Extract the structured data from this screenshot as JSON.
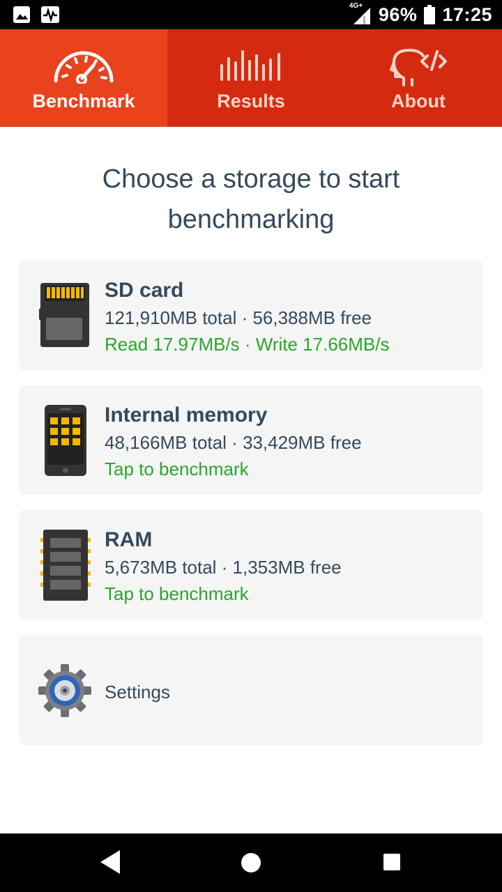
{
  "status_bar": {
    "network_type": "4G+",
    "battery": "96%",
    "time": "17:25"
  },
  "tabs": [
    {
      "label": "Benchmark",
      "icon": "speedometer-icon",
      "active": true
    },
    {
      "label": "Results",
      "icon": "bars-icon",
      "active": false
    },
    {
      "label": "About",
      "icon": "head-code-icon",
      "active": false
    }
  ],
  "heading": {
    "line1": "Choose a storage to start",
    "line2": "benchmarking"
  },
  "storages": [
    {
      "title": "SD card",
      "capacity": "121,910MB total · 56,388MB free",
      "status": "Read 17.97MB/s · Write 17.66MB/s",
      "icon": "sd-card-icon"
    },
    {
      "title": "Internal memory",
      "capacity": "48,166MB total · 33,429MB free",
      "status": "Tap to benchmark",
      "icon": "phone-memory-icon"
    },
    {
      "title": "RAM",
      "capacity": "5,673MB total · 1,353MB free",
      "status": "Tap to benchmark",
      "icon": "ram-chip-icon"
    }
  ],
  "settings": {
    "label": "Settings",
    "icon": "gear-icon"
  },
  "colors": {
    "tab_bar": "#d42a10",
    "tab_active": "#e8431c",
    "text_dark": "#34495e",
    "status_green": "#2aa52a",
    "card_bg": "#f5f5f5"
  }
}
